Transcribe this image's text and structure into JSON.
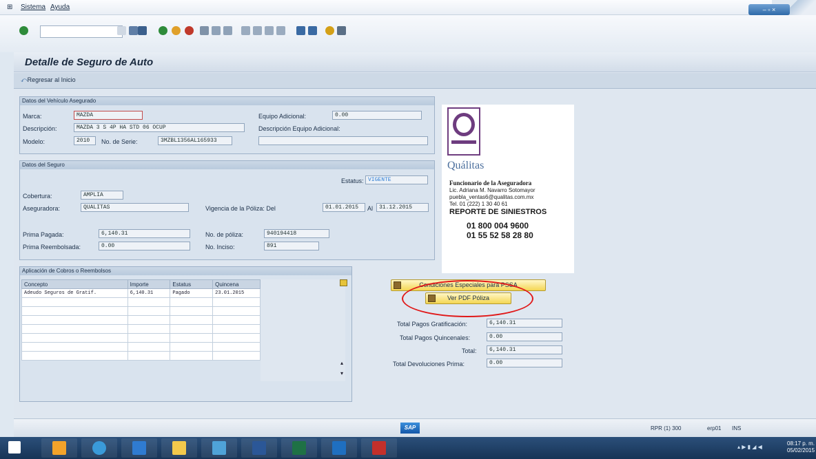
{
  "menu": {
    "sistema": "Sistema",
    "ayuda": "Ayuda"
  },
  "window": {
    "controls": "– ▫ ×"
  },
  "page": {
    "title": "Detalle de Seguro de Auto",
    "back": "Regresar al Inicio"
  },
  "vehiculo": {
    "group_title": "Datos del Vehículo Asegurado",
    "marca_label": "Marca:",
    "marca": "MAZDA",
    "descripcion_label": "Descripción:",
    "descripcion": "MAZDA 3 S 4P HA STD 06 OCUP",
    "modelo_label": "Modelo:",
    "modelo": "2010",
    "serie_label": "No. de Serie:",
    "serie": "3MZBL1356AL165933",
    "equipo_label": "Equipo Adicional:",
    "equipo": "0.00",
    "desc_equipo_label": "Descripción Equipo Adicional:",
    "desc_equipo": ""
  },
  "seguro": {
    "group_title": "Datos del Seguro",
    "estatus_label": "Estatus:",
    "estatus": "VIGENTE",
    "cobertura_label": "Cobertura:",
    "cobertura": "AMPLIA",
    "aseguradora_label": "Aseguradora:",
    "aseguradora": "QUALITAS",
    "vigencia_label": "Vigencia de la Póliza: Del",
    "vigencia_del": "01.01.2015",
    "al_label": "Al",
    "vigencia_al": "31.12.2015",
    "prima_pagada_label": "Prima Pagada:",
    "prima_pagada": "6,140.31",
    "prima_reemb_label": "Prima Reembolsada:",
    "prima_reemb": "0.00",
    "poliza_label": "No. de póliza:",
    "poliza": "940194418",
    "inciso_label": "No. Inciso:",
    "inciso": "891"
  },
  "logo": {
    "brand": "Quálitas",
    "funcionario_title": "Funcionario de la Aseguradora",
    "funcionario_name": "Lic. Adriana M. Navarro Sotomayor",
    "email": "puebla_ventas6@qualitas.com.mx",
    "tel": "Tel. 01 (222) 1 30 40 61",
    "reporte": "REPORTE DE SINIESTROS",
    "phone1": "01 800 004 9600",
    "phone2": "01 55 52 58 28 80"
  },
  "cobros": {
    "group_title": "Aplicación de Cobros o Reembolsos",
    "headers": [
      "Concepto",
      "Importe",
      "Estatus",
      "Quincena"
    ],
    "rows": [
      [
        "Adeudo Seguros de Gratif.",
        "6,140.31",
        "Pagado",
        "23.01.2015"
      ]
    ]
  },
  "buttons": {
    "condiciones": "Condiciones Especiales para PSSA",
    "ver_pdf": "Ver PDF Póliza"
  },
  "totales": {
    "gratif_label": "Total Pagos Gratificación:",
    "gratif": "6,140.31",
    "quinc_label": "Total Pagos Quincenales:",
    "quinc": "0.00",
    "total_label": "Total:",
    "total": "6,140.31",
    "devol_label": "Total Devoluciones Prima:",
    "devol": "0.00"
  },
  "status": {
    "sap": "SAP",
    "session": "RPR (1) 300",
    "server": "erp01",
    "mode": "INS"
  },
  "clock": {
    "time": "08:17 p. m.",
    "date": "05/02/2015"
  }
}
